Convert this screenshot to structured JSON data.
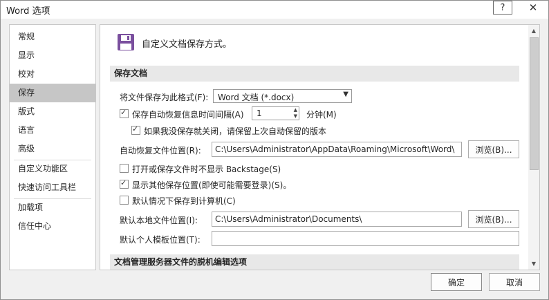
{
  "window": {
    "title": "Word 选项",
    "help_label": "?",
    "close_label": "✕"
  },
  "nav": {
    "items": [
      {
        "label": "常规"
      },
      {
        "label": "显示"
      },
      {
        "label": "校对"
      },
      {
        "label": "保存",
        "active": true
      },
      {
        "label": "版式"
      },
      {
        "label": "语言"
      },
      {
        "label": "高级"
      },
      {
        "label": "自定义功能区"
      },
      {
        "label": "快速访问工具栏"
      },
      {
        "label": "加载项"
      },
      {
        "label": "信任中心"
      }
    ]
  },
  "content": {
    "header": "自定义文档保存方式。",
    "section_save": "保存文档",
    "format_label": "将文件保存为此格式(F):",
    "format_value": "Word 文档 (*.docx)",
    "autorecover_label": "保存自动恢复信息时间间隔(A)",
    "autorecover_value": "1",
    "minutes_label": "分钟(M)",
    "keep_last_label": "如果我没保存就关闭，请保留上次自动保留的版本",
    "autorecover_loc_label": "自动恢复文件位置(R):",
    "autorecover_loc_value": "C:\\Users\\Administrator\\AppData\\Roaming\\Microsoft\\Word\\",
    "browse_label": "浏览(B)...",
    "no_backstage_label": "打开或保存文件时不显示 Backstage(S)",
    "show_more_locations_label": "显示其他保存位置(即使可能需要登录)(S)。",
    "save_to_computer_label": "默认情况下保存到计算机(C)",
    "default_local_label": "默认本地文件位置(I):",
    "default_local_value": "C:\\Users\\Administrator\\Documents\\",
    "browse2_label": "浏览(B)...",
    "personal_template_label": "默认个人模板位置(T):",
    "personal_template_value": "",
    "section_offline": "文档管理服务器文件的脱机编辑选项"
  },
  "checkbox_states": {
    "autorecover": true,
    "keep_last": true,
    "no_backstage": false,
    "show_more_locations": true,
    "save_to_computer": false
  },
  "footer": {
    "ok_label": "确定",
    "cancel_label": "取消"
  },
  "colors": {
    "accent_icon": "#7a4f9e",
    "nav_active": "#c6c6c6",
    "section_header_bg": "#e8e8e8"
  }
}
